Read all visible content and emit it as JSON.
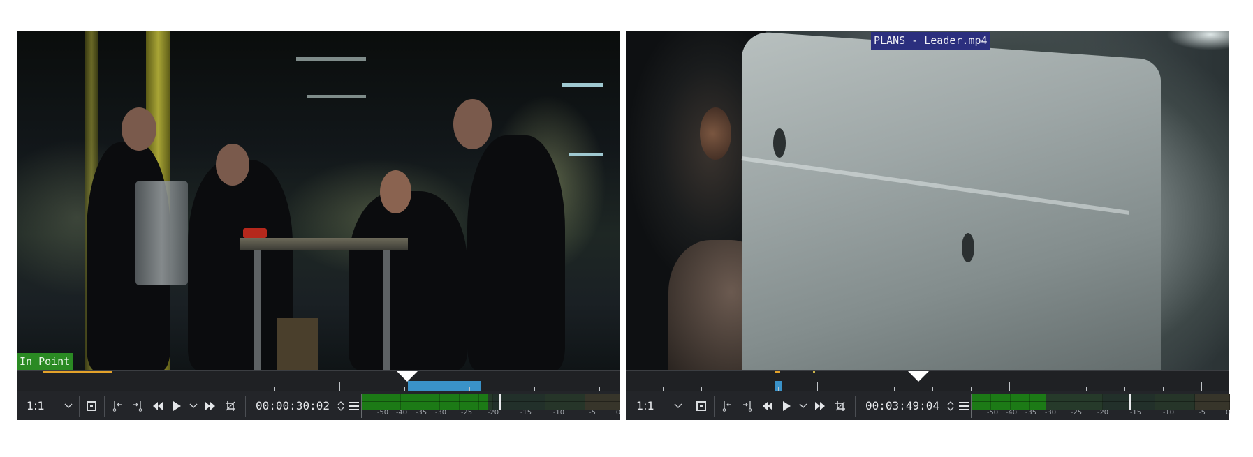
{
  "monitors": [
    {
      "id": "clip-monitor",
      "overlay_label": "In Point",
      "zoom": "1:1",
      "timecode": "00:00:30:02",
      "meter": {
        "level_db": -21,
        "peak_db": -19,
        "labels": [
          "-50",
          "-40",
          "-35",
          "-30",
          "-25",
          "-20",
          "-15",
          "-10",
          "-5",
          "0"
        ]
      }
    },
    {
      "id": "project-monitor",
      "overlay_label": "PLANS - Leader.mp4",
      "zoom": "1:1",
      "timecode": "00:03:49:04",
      "meter": {
        "level_db": -31,
        "peak_db": -16,
        "labels": [
          "-50",
          "-40",
          "-35",
          "-30",
          "-25",
          "-20",
          "-15",
          "-10",
          "-5",
          "0"
        ]
      }
    }
  ],
  "icons": {
    "zoom_dropdown": "chevron-down-icon",
    "safe_zone": "safe-zone-icon",
    "set_in": "set-in-point-icon",
    "set_out": "set-out-point-icon",
    "rewind": "rewind-icon",
    "play": "play-icon",
    "play_options": "chevron-down-icon",
    "forward": "fast-forward-icon",
    "crop": "crop-icon",
    "timecode_spin": "spinner-arrows-icon",
    "menu": "hamburger-menu-icon"
  },
  "colors": {
    "in_point_badge": "#2a8a23",
    "title_badge": "#2b2f7e",
    "zone": "#3a92c8",
    "marker": "#e3a22a",
    "meter_green": "#1c7a16"
  }
}
